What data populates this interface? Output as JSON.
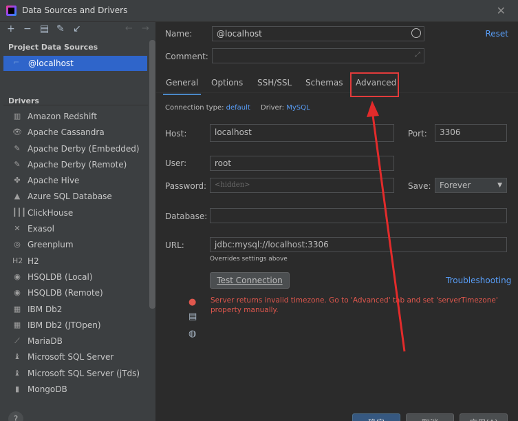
{
  "window": {
    "title": "Data Sources and Drivers",
    "close_icon": "close-icon"
  },
  "sidebar": {
    "project_title": "Project Data Sources",
    "selected": "@localhost",
    "drivers_title": "Drivers",
    "drivers": [
      {
        "label": "Amazon Redshift",
        "icon": "▥"
      },
      {
        "label": "Apache Cassandra",
        "icon": "👁"
      },
      {
        "label": "Apache Derby (Embedded)",
        "icon": "✎"
      },
      {
        "label": "Apache Derby (Remote)",
        "icon": "✎"
      },
      {
        "label": "Apache Hive",
        "icon": "✤"
      },
      {
        "label": "Azure SQL Database",
        "icon": "▲"
      },
      {
        "label": "ClickHouse",
        "icon": "┃┃┃"
      },
      {
        "label": "Exasol",
        "icon": "✕"
      },
      {
        "label": "Greenplum",
        "icon": "◎"
      },
      {
        "label": "H2",
        "icon": "H2"
      },
      {
        "label": "HSQLDB (Local)",
        "icon": "◉"
      },
      {
        "label": "HSQLDB (Remote)",
        "icon": "◉"
      },
      {
        "label": "IBM Db2",
        "icon": "▦"
      },
      {
        "label": "IBM Db2 (JTOpen)",
        "icon": "▦"
      },
      {
        "label": "MariaDB",
        "icon": "⟋"
      },
      {
        "label": "Microsoft SQL Server",
        "icon": "♝"
      },
      {
        "label": "Microsoft SQL Server (jTds)",
        "icon": "♝"
      },
      {
        "label": "MongoDB",
        "icon": "▮"
      }
    ],
    "help": "?"
  },
  "form": {
    "name_label": "Name:",
    "name_value": "@localhost",
    "reset": "Reset",
    "comment_label": "Comment:",
    "tabs": [
      "General",
      "Options",
      "SSH/SSL",
      "Schemas",
      "Advanced"
    ],
    "connection_type_label": "Connection type:",
    "connection_type_value": "default",
    "driver_label": "Driver:",
    "driver_value": "MySQL",
    "host_label": "Host:",
    "host_value": "localhost",
    "port_label": "Port:",
    "port_value": "3306",
    "user_label": "User:",
    "user_value": "root",
    "password_label": "Password:",
    "password_placeholder": "<hidden>",
    "save_label": "Save:",
    "save_value": "Forever",
    "database_label": "Database:",
    "url_label": "URL:",
    "url_value": "jdbc:mysql://localhost:3306",
    "url_note": "Overrides settings above",
    "test_connection": "Test Connection",
    "troubleshooting": "Troubleshooting",
    "error": "Server returns invalid timezone. Go to 'Advanced' tab and set 'serverTimezone' property manually."
  },
  "footer": {
    "ok": "确定",
    "cancel": "取消",
    "apply": "应用(A)"
  },
  "colors": {
    "accent": "#589df6",
    "error": "#e0574d",
    "highlight": "#e23b3b"
  }
}
